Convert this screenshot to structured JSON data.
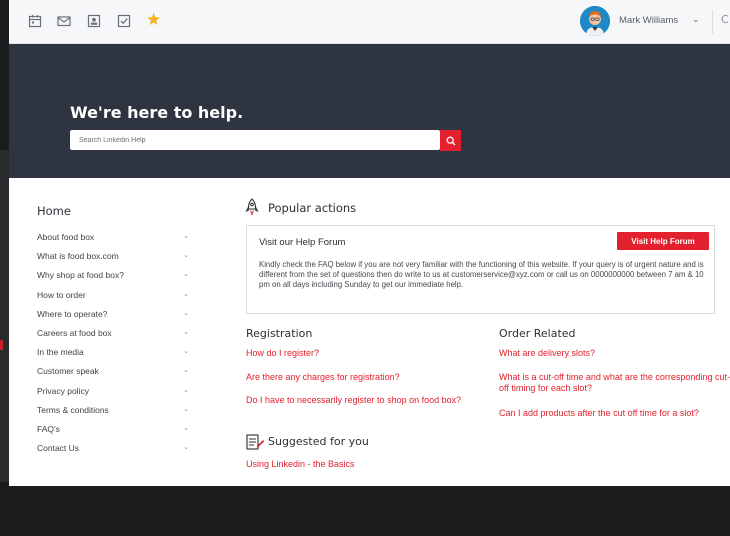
{
  "topbar": {
    "icons": [
      "calendar-icon",
      "mail-icon",
      "contact-card-icon",
      "checkbox-icon",
      "star-icon"
    ],
    "user_name": "Mark Williams",
    "user_caret": "⌄",
    "trailing": "C"
  },
  "hero": {
    "title": "We're here to help.",
    "search_placeholder": "Search Linkedin Help"
  },
  "sidebar": {
    "heading": "Home",
    "items": [
      {
        "label": "About food box"
      },
      {
        "label": "What is food box.com"
      },
      {
        "label": "Why shop at food box?"
      },
      {
        "label": "How to order"
      },
      {
        "label": "Where to operate?"
      },
      {
        "label": "Careers at food box"
      },
      {
        "label": "In the media"
      },
      {
        "label": "Customer speak"
      },
      {
        "label": "Privacy policy"
      },
      {
        "label": "Terms & conditions"
      },
      {
        "label": "FAQ's"
      },
      {
        "label": "Contact Us"
      }
    ]
  },
  "popular": {
    "title": "Popular actions",
    "forum_title": "Visit our Help Forum",
    "forum_button": "Visit Help Forum",
    "forum_text": "Kindly check the FAQ below if you are not very familiar with the functioning of this website. If your query is of urgent nature and is different from the set of questions then do write to us at customerservice@xyz.com or call us on 0000000000 between 7 am & 10 pm on all days including Sunday to get our immediate help."
  },
  "registration": {
    "heading": "Registration",
    "links": [
      "How do I register?",
      "Are there any charges for registration?",
      "Do I have to necessarily register to shop on food box?"
    ]
  },
  "order_related": {
    "heading": "Order Related",
    "links": [
      "What are delivery slots?",
      "What is a cut-off time and what are the corresponding cut-off timing for each slot?",
      "Can I add products after the cut off time for a slot?"
    ]
  },
  "suggested": {
    "title": "Suggested for you",
    "links": [
      "Using Linkedin - the Basics"
    ]
  },
  "colors": {
    "accent_red": "#e3202e",
    "hero_bg": "#2e3440",
    "star": "#f2b01e"
  }
}
